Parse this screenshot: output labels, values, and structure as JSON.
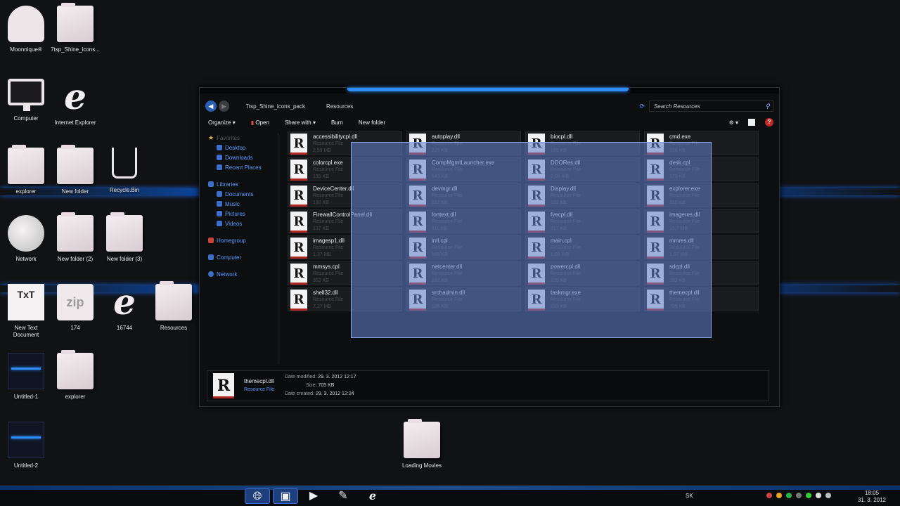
{
  "desktop": {
    "icons": [
      {
        "id": "moonnique",
        "label": "Moonnique®"
      },
      {
        "id": "shine",
        "label": "7tsp_Shine_icons..."
      },
      {
        "id": "computer",
        "label": "Computer"
      },
      {
        "id": "ie",
        "label": "Internet Explorer"
      },
      {
        "id": "explorer",
        "label": "explorer"
      },
      {
        "id": "newfolder",
        "label": "New folder"
      },
      {
        "id": "recyclebin",
        "label": "Recycle.Bin"
      },
      {
        "id": "network",
        "label": "Network"
      },
      {
        "id": "newfolder2",
        "label": "New folder (2)"
      },
      {
        "id": "newfolder3",
        "label": "New folder (3)"
      },
      {
        "id": "newtext",
        "label": "New Text Document"
      },
      {
        "id": "zip174",
        "label": "174"
      },
      {
        "id": "ie16744",
        "label": "16744"
      },
      {
        "id": "resources",
        "label": "Resources"
      },
      {
        "id": "untitled1",
        "label": "Untitled-1"
      },
      {
        "id": "explorer2",
        "label": "explorer"
      },
      {
        "id": "untitled2",
        "label": "Untitled-2"
      },
      {
        "id": "loadingmovies",
        "label": "Loading Movies"
      }
    ],
    "zip_text": "zip",
    "txt_text": "TxT"
  },
  "window": {
    "breadcrumb": [
      "7tsp_Shine_icons_pack",
      "Resources"
    ],
    "search_placeholder": "Search Resources",
    "toolbar": {
      "organize": "Organize",
      "open": "Open",
      "share": "Share with",
      "burn": "Burn",
      "new_folder": "New folder"
    },
    "nav": {
      "favorites": "Favorites",
      "desktop": "Desktop",
      "downloads": "Downloads",
      "recent": "Recent Places",
      "libraries": "Libraries",
      "documents": "Documents",
      "music": "Music",
      "pictures": "Pictures",
      "videos": "Videos",
      "homegroup": "Homegroup",
      "computer": "Computer",
      "network": "Network"
    },
    "files": [
      [
        {
          "name": "accessibilitycpl.dll",
          "type": "Resource File",
          "size": "2,59 MB"
        },
        {
          "name": "autoplay.dll",
          "type": "Resource File",
          "size": "225 KB"
        },
        {
          "name": "biocpl.dll",
          "type": "Resource File",
          "size": "165 KB"
        },
        {
          "name": "cmd.exe",
          "type": "Resource File",
          "size": "108 KB"
        }
      ],
      [
        {
          "name": "colorcpl.exe",
          "type": "Resource File",
          "size": "155 KB"
        },
        {
          "name": "CompMgmtLauncher.exe",
          "type": "Resource File",
          "size": "143 KB"
        },
        {
          "name": "DDORes.dll",
          "type": "Resource File",
          "size": "2,09 MB"
        },
        {
          "name": "desk.cpl",
          "type": "Resource File",
          "size": "179 KB"
        }
      ],
      [
        {
          "name": "DeviceCenter.dll",
          "type": "Resource File",
          "size": "190 KB"
        },
        {
          "name": "devmgr.dll",
          "type": "Resource File",
          "size": "112 KB"
        },
        {
          "name": "Display.dll",
          "type": "Resource File",
          "size": "102 KB"
        },
        {
          "name": "explorer.exe",
          "type": "Resource File",
          "size": "315 KB"
        }
      ],
      [
        {
          "name": "FirewallControlPanel.dll",
          "type": "Resource File",
          "size": "137 KB"
        },
        {
          "name": "fontext.dll",
          "type": "Resource File",
          "size": "111 KB"
        },
        {
          "name": "fvecpl.dll",
          "type": "Resource File",
          "size": "217 KB"
        },
        {
          "name": "imageres.dll",
          "type": "Resource File",
          "size": "15,7 MB"
        }
      ],
      [
        {
          "name": "imagesp1.dll",
          "type": "Resource File",
          "size": "1,37 MB"
        },
        {
          "name": "intl.cpl",
          "type": "Resource File",
          "size": "169 KB"
        },
        {
          "name": "main.cpl",
          "type": "Resource File",
          "size": "1,09 MB"
        },
        {
          "name": "mmres.dll",
          "type": "Resource File",
          "size": "1,07 MB"
        }
      ],
      [
        {
          "name": "mmsys.cpl",
          "type": "Resource File",
          "size": "352 KB"
        },
        {
          "name": "netcenter.dll",
          "type": "Resource File",
          "size": "192 KB"
        },
        {
          "name": "powercpl.dll",
          "type": "Resource File",
          "size": "225 KB"
        },
        {
          "name": "sdcpl.dll",
          "type": "Resource File",
          "size": "282 KB"
        }
      ],
      [
        {
          "name": "shell32.dll",
          "type": "Resource File",
          "size": "7,27 MB"
        },
        {
          "name": "srchadmin.dll",
          "type": "Resource File",
          "size": "106 KB"
        },
        {
          "name": "taskmgr.exe",
          "type": "Resource File",
          "size": "233 KB"
        },
        {
          "name": "themecpl.dll",
          "type": "Resource File",
          "size": "705 KB"
        }
      ]
    ],
    "details": {
      "name": "themecpl.dll",
      "type": "Resource File",
      "modified_label": "Date modified:",
      "modified": "29. 3. 2012 12:17",
      "size_label": "Size:",
      "size": "705 KB",
      "created_label": "Date created:",
      "created": "29. 3. 2012 12:24"
    },
    "icon_letter": "R"
  },
  "taskbar": {
    "lang": "SK",
    "time": "18:05",
    "date": "31. 3. 2012"
  }
}
